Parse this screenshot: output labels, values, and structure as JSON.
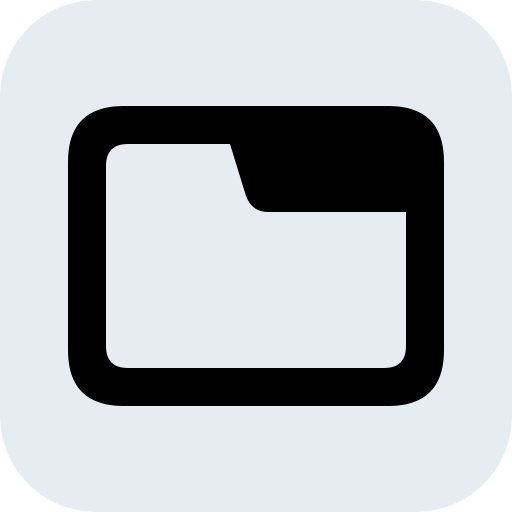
{
  "icon": {
    "semantic_name": "folder-tab-icon",
    "background_color": "#E6ECF2",
    "stroke_color": "#000000"
  }
}
